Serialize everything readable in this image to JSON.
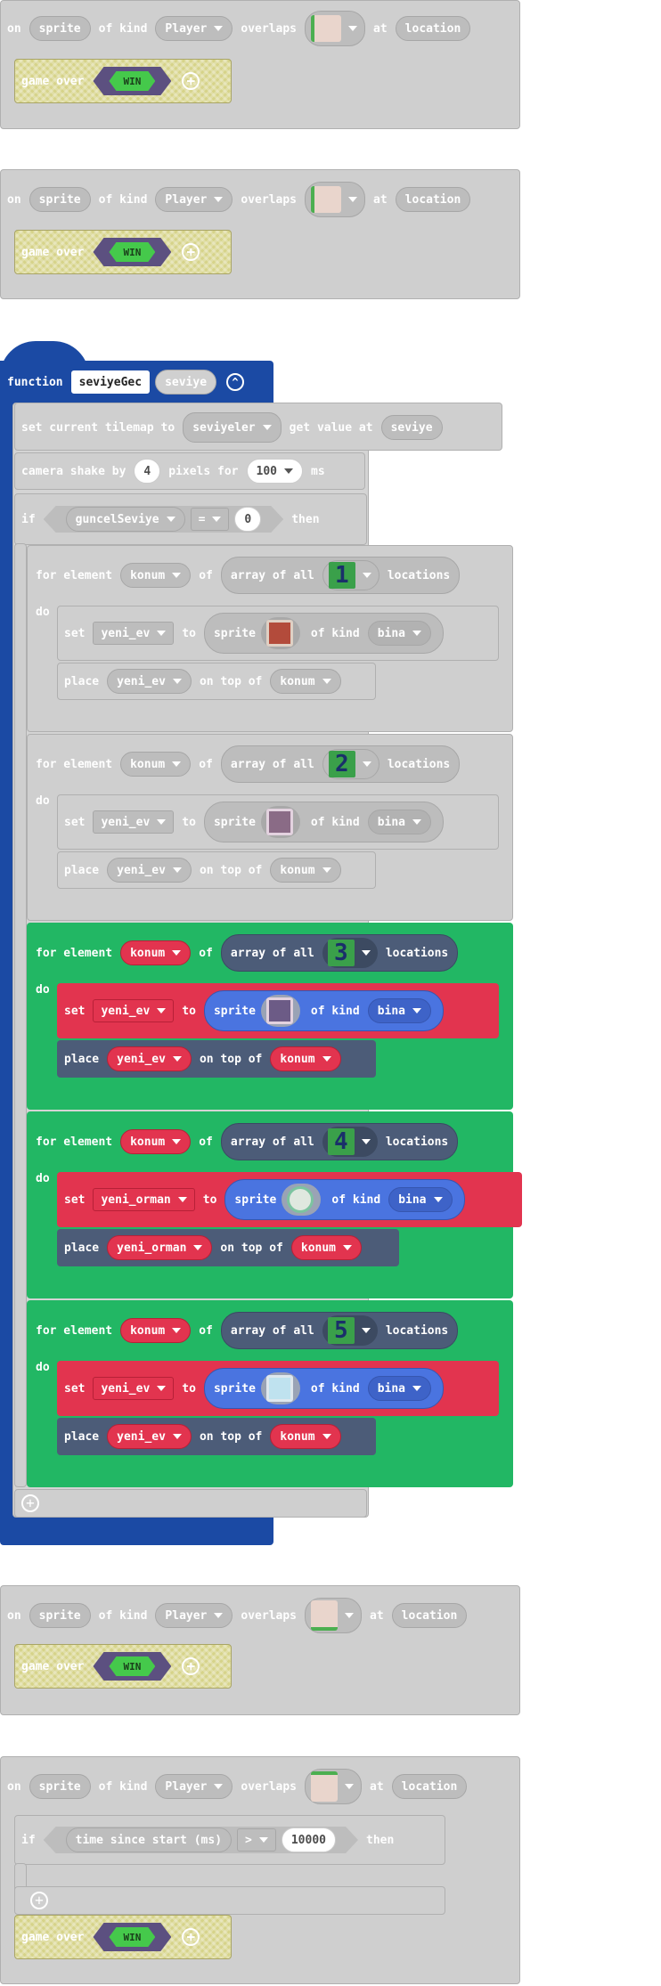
{
  "colors": {
    "function_blue": "#1b4aa4",
    "loop_green": "#22b764",
    "var_red": "#e2344f",
    "sprite_blue": "#4a74e0",
    "slate": "#4c5c78",
    "disabled_grey": "#cfcfcf",
    "game_over_khaki": "#d6d389"
  },
  "events": [
    {
      "on": "on",
      "sprite": "sprite",
      "of_kind": "of kind",
      "kind": "Player",
      "overlaps": "overlaps",
      "at": "at",
      "location": "location",
      "tile_icon": "door-tile-icon",
      "body": {
        "game_over": "game over",
        "win": "WIN"
      }
    },
    {
      "on": "on",
      "sprite": "sprite",
      "of_kind": "of kind",
      "kind": "Player",
      "overlaps": "overlaps",
      "at": "at",
      "location": "location",
      "tile_icon": "door-tile-icon",
      "body": {
        "game_over": "game over",
        "win": "WIN"
      }
    },
    {
      "on": "on",
      "sprite": "sprite",
      "of_kind": "of kind",
      "kind": "Player",
      "overlaps": "overlaps",
      "at": "at",
      "location": "location",
      "tile_icon": "door-tile-icon",
      "body": {
        "game_over": "game over",
        "win": "WIN"
      }
    },
    {
      "on": "on",
      "sprite": "sprite",
      "of_kind": "of kind",
      "kind": "Player",
      "overlaps": "overlaps",
      "at": "at",
      "location": "location",
      "tile_icon": "door-tile-icon",
      "if": {
        "if": "if",
        "lhs": "time since start (ms)",
        "op": ">",
        "rhs": "10000",
        "then": "then"
      },
      "body": {
        "game_over": "game over",
        "win": "WIN"
      }
    }
  ],
  "function": {
    "keyword": "function",
    "name": "seviyeGec",
    "param": "seviye",
    "tilemap": {
      "label": "set current tilemap to",
      "source": "seviyeler",
      "get": "get value at",
      "index": "seviye"
    },
    "shake": {
      "label": "camera shake by",
      "amount": "4",
      "pixels_for": "pixels for",
      "duration": "100",
      "ms": "ms"
    },
    "if": {
      "if": "if",
      "lhs": "guncelSeviye",
      "op": "=",
      "rhs": "0",
      "then": "then"
    },
    "loops": [
      {
        "for": "for element",
        "var": "konum",
        "of": "of",
        "array": "array of all",
        "tile": "1",
        "locations": "locations",
        "do": "do",
        "set": "set",
        "target": "yeni_ev",
        "to": "to",
        "sprite": "sprite",
        "sprite_icon": "brick-house-icon",
        "of_kind": "of kind",
        "kind": "bina",
        "place": "place",
        "on_top_of": "on top of",
        "state": "disabled"
      },
      {
        "for": "for element",
        "var": "konum",
        "of": "of",
        "array": "array of all",
        "tile": "2",
        "locations": "locations",
        "do": "do",
        "set": "set",
        "target": "yeni_ev",
        "to": "to",
        "sprite": "sprite",
        "sprite_icon": "purple-house-icon",
        "of_kind": "of kind",
        "kind": "bina",
        "place": "place",
        "on_top_of": "on top of",
        "state": "disabled"
      },
      {
        "for": "for element",
        "var": "konum",
        "of": "of",
        "array": "array of all",
        "tile": "3",
        "locations": "locations",
        "do": "do",
        "set": "set",
        "target": "yeni_ev",
        "to": "to",
        "sprite": "sprite",
        "sprite_icon": "purple-house-icon",
        "of_kind": "of kind",
        "kind": "bina",
        "place": "place",
        "on_top_of": "on top of",
        "state": "enabled"
      },
      {
        "for": "for element",
        "var": "konum",
        "of": "of",
        "array": "array of all",
        "tile": "4",
        "locations": "locations",
        "do": "do",
        "set": "set",
        "target": "yeni_orman",
        "to": "to",
        "sprite": "sprite",
        "sprite_icon": "tree-icon",
        "of_kind": "of kind",
        "kind": "bina",
        "place": "place",
        "on_top_of": "on top of",
        "state": "enabled"
      },
      {
        "for": "for element",
        "var": "konum",
        "of": "of",
        "array": "array of all",
        "tile": "5",
        "locations": "locations",
        "do": "do",
        "set": "set",
        "target": "yeni_ev",
        "to": "to",
        "sprite": "sprite",
        "sprite_icon": "ice-house-icon",
        "of_kind": "of kind",
        "kind": "bina",
        "place": "place",
        "on_top_of": "on top of",
        "state": "enabled"
      }
    ]
  }
}
